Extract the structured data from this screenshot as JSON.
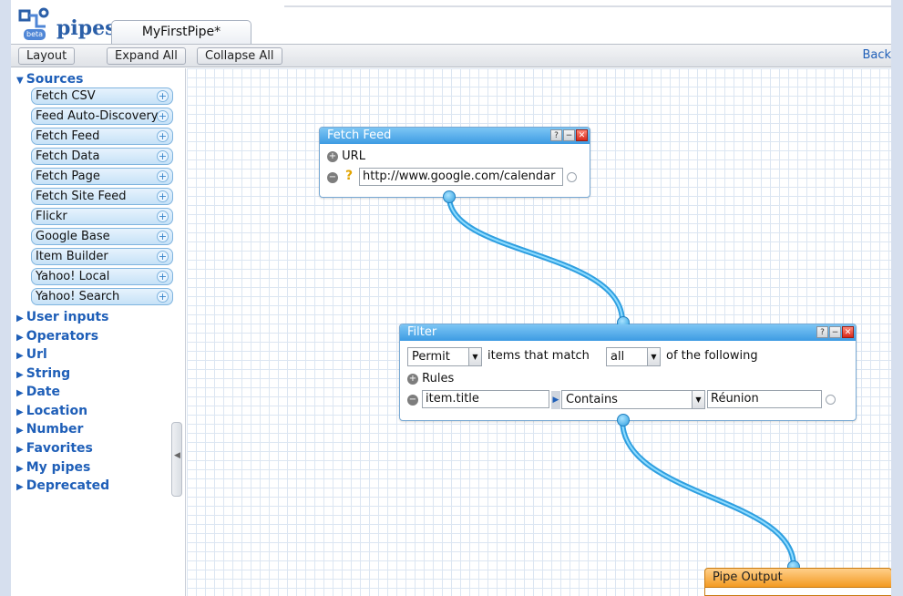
{
  "app": {
    "logo_text": "pipes",
    "beta": "beta",
    "tab_title": "MyFirstPipe*"
  },
  "toolbar": {
    "layout": "Layout",
    "expand_all": "Expand All",
    "collapse_all": "Collapse All",
    "back": "Back"
  },
  "sidebar": {
    "sources_title": "Sources",
    "sources": [
      "Fetch CSV",
      "Feed Auto-Discovery",
      "Fetch Feed",
      "Fetch Data",
      "Fetch Page",
      "Fetch Site Feed",
      "Flickr",
      "Google Base",
      "Item Builder",
      "Yahoo! Local",
      "Yahoo! Search"
    ],
    "categories": [
      "User inputs",
      "Operators",
      "Url",
      "String",
      "Date",
      "Location",
      "Number",
      "Favorites",
      "My pipes",
      "Deprecated"
    ]
  },
  "fetch_feed": {
    "title": "Fetch Feed",
    "url_label": "URL",
    "url_value": "http://www.google.com/calendar"
  },
  "filter": {
    "title": "Filter",
    "mode": "Permit",
    "text_items_match": "items that match",
    "match": "all",
    "text_following": "of the following",
    "rules_label": "Rules",
    "rule_field": "item.title",
    "rule_operator": "Contains",
    "rule_value": "Réunion"
  },
  "output": {
    "title": "Pipe Output"
  },
  "icons": {
    "help": "?",
    "minimize": "−",
    "close": "✕",
    "plus": "+",
    "minus": "−"
  }
}
